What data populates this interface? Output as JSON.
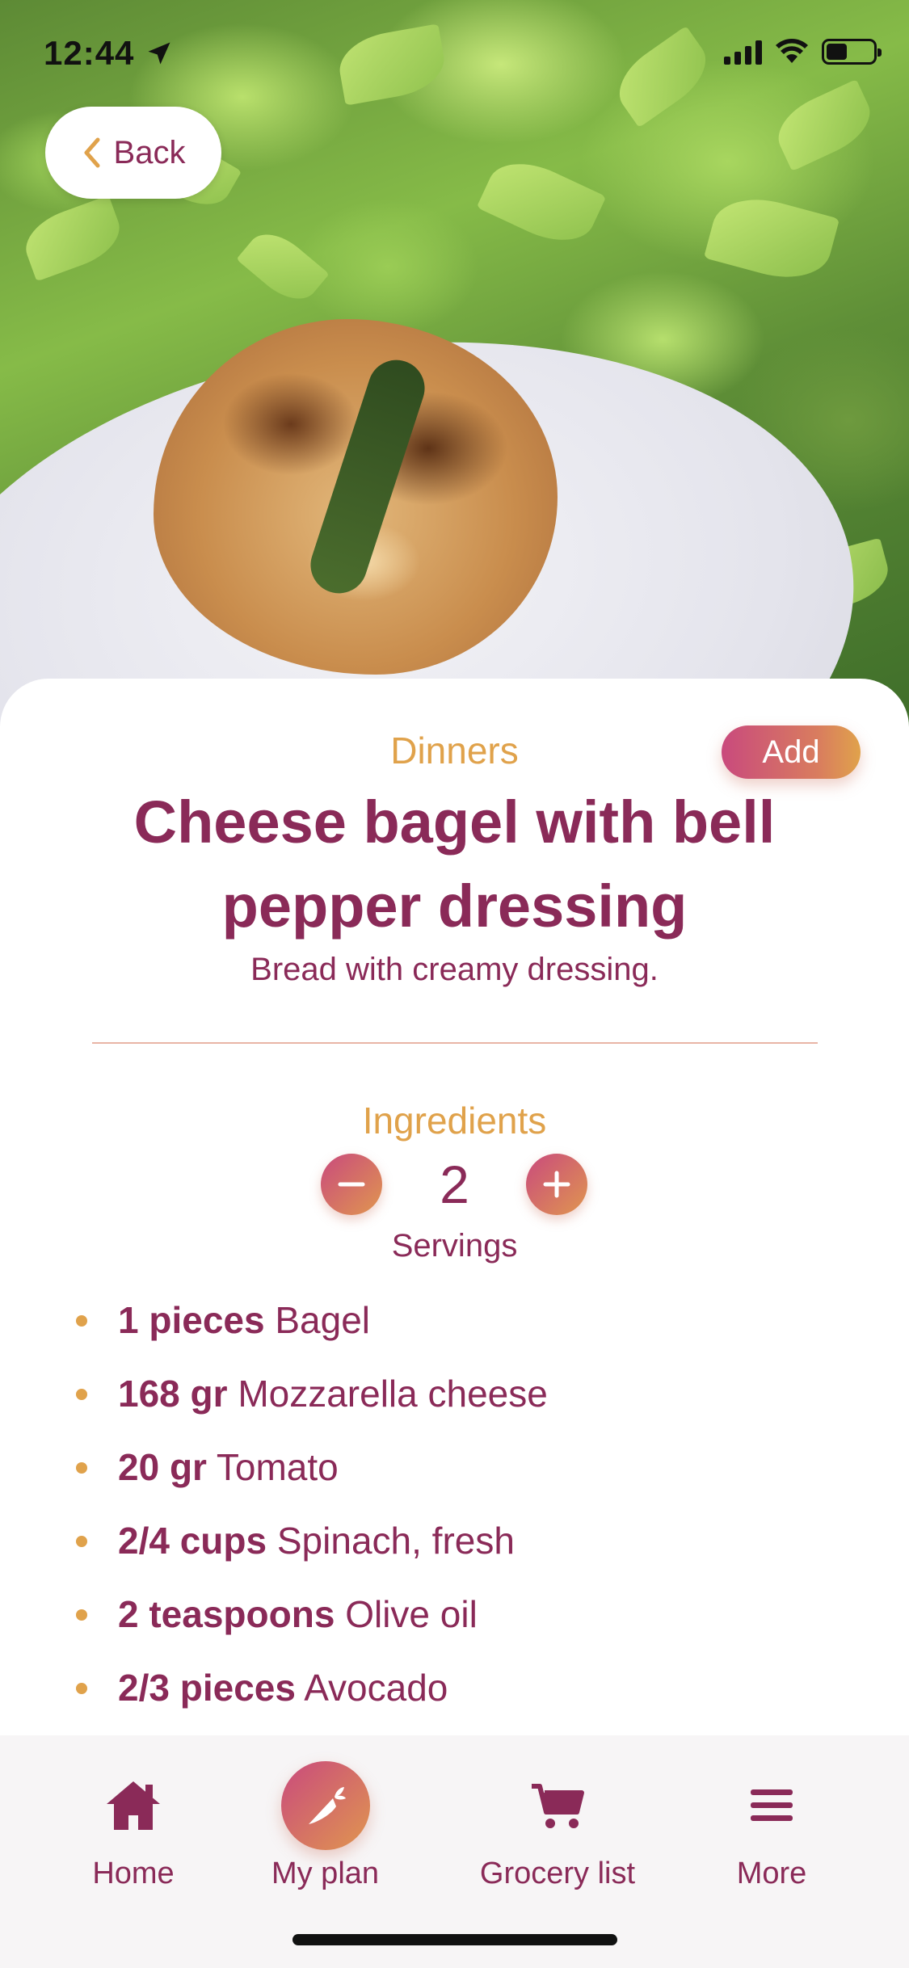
{
  "status_bar": {
    "time": "12:44"
  },
  "nav": {
    "back_label": "Back"
  },
  "recipe": {
    "category": "Dinners",
    "add_label": "Add",
    "title": "Cheese bagel with bell pepper dressing",
    "description": "Bread with creamy dressing."
  },
  "ingredients": {
    "heading": "Ingredients",
    "servings_count": "2",
    "servings_label": "Servings",
    "items": [
      {
        "qty": "1 pieces",
        "name": "Bagel"
      },
      {
        "qty": "168 gr",
        "name": "Mozzarella cheese"
      },
      {
        "qty": "20 gr",
        "name": "Tomato"
      },
      {
        "qty": "2/4 cups",
        "name": "Spinach, fresh"
      },
      {
        "qty": "2 teaspoons",
        "name": "Olive oil"
      },
      {
        "qty": "2/3 pieces",
        "name": "Avocado"
      }
    ]
  },
  "tabbar": {
    "home": "Home",
    "plan": "My plan",
    "grocery": "Grocery list",
    "more": "More"
  },
  "colors": {
    "brand": "#8a2a58",
    "accent": "#e0a24b",
    "gradient_start": "#c94a7d",
    "gradient_end": "#e0964f"
  },
  "icons": {
    "back": "chevron-left-icon",
    "minus": "minus-icon",
    "plus": "plus-icon",
    "home": "home-icon",
    "plan": "carrot-icon",
    "grocery": "cart-icon",
    "more": "menu-icon"
  }
}
